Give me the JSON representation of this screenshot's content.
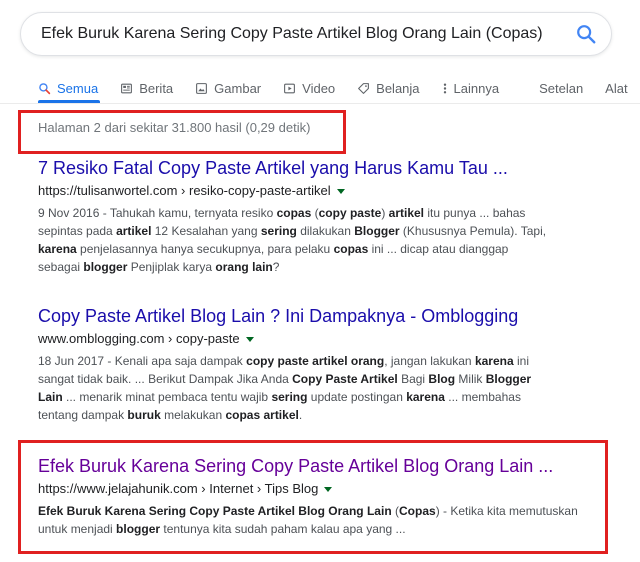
{
  "search": {
    "query": "Efek Buruk Karena Sering Copy Paste Artikel Blog Orang Lain (Copas)"
  },
  "tabs": [
    {
      "label": "Semua",
      "icon": "search-icon",
      "active": true
    },
    {
      "label": "Berita",
      "icon": "newspaper-icon"
    },
    {
      "label": "Gambar",
      "icon": "image-icon"
    },
    {
      "label": "Video",
      "icon": "video-icon"
    },
    {
      "label": "Belanja",
      "icon": "shopping-tag-icon"
    },
    {
      "label": "Lainnya",
      "icon": "more-vert-icon"
    },
    {
      "label": "Setelan"
    },
    {
      "label": "Alat"
    }
  ],
  "result_stats": "Halaman 2 dari sekitar 31.800 hasil (0,29 detik)",
  "results": [
    {
      "title": "7 Resiko Fatal Copy Paste Artikel yang Harus Kamu Tau ...",
      "url": "https://tulisanwortel.com › resiko-copy-paste-artikel",
      "snippet_lines": [
        [
          [
            "9 Nov 2016 - Tahukah kamu, ternyata resiko ",
            0
          ],
          [
            "copas",
            1
          ],
          [
            " (",
            0
          ],
          [
            "copy paste",
            1
          ],
          [
            ") ",
            0
          ],
          [
            "artikel",
            1
          ],
          [
            " itu punya ... bahas",
            0
          ]
        ],
        [
          [
            "sepintas pada ",
            0
          ],
          [
            "artikel",
            1
          ],
          [
            " 12 Kesalahan yang ",
            0
          ],
          [
            "sering",
            1
          ],
          [
            " dilakukan ",
            0
          ],
          [
            "Blogger",
            1
          ],
          [
            " (Khususnya Pemula). Tapi,",
            0
          ]
        ],
        [
          [
            "karena",
            1
          ],
          [
            " penjelasannya hanya secukupnya, para pelaku ",
            0
          ],
          [
            "copas",
            1
          ],
          [
            " ini ... dicap atau dianggap",
            0
          ]
        ],
        [
          [
            "sebagai ",
            0
          ],
          [
            "blogger",
            1
          ],
          [
            " Penjiplak karya ",
            0
          ],
          [
            "orang lain",
            1
          ],
          [
            "?",
            0
          ]
        ]
      ]
    },
    {
      "title": "Copy Paste Artikel Blog Lain ? Ini Dampaknya - Omblogging",
      "url": "www.omblogging.com › copy-paste",
      "snippet_lines": [
        [
          [
            "18 Jun 2017 - Kenali apa saja dampak ",
            0
          ],
          [
            "copy paste artikel orang",
            1
          ],
          [
            ", jangan lakukan ",
            0
          ],
          [
            "karena",
            1
          ],
          [
            " ini",
            0
          ]
        ],
        [
          [
            "sangat tidak baik. ... Berikut Dampak Jika Anda ",
            0
          ],
          [
            "Copy Paste Artikel",
            1
          ],
          [
            " Bagi ",
            0
          ],
          [
            "Blog",
            1
          ],
          [
            " Milik ",
            0
          ],
          [
            "Blogger",
            1
          ]
        ],
        [
          [
            "Lain",
            1
          ],
          [
            " ... menarik minat pembaca tentu wajib ",
            0
          ],
          [
            "sering",
            1
          ],
          [
            " update postingan ",
            0
          ],
          [
            "karena",
            1
          ],
          [
            " ... membahas",
            0
          ]
        ],
        [
          [
            "tentang dampak ",
            0
          ],
          [
            "buruk",
            1
          ],
          [
            " melakukan ",
            0
          ],
          [
            "copas artikel",
            1
          ],
          [
            ".",
            0
          ]
        ]
      ]
    },
    {
      "title": "Efek Buruk Karena Sering Copy Paste Artikel Blog Orang Lain ...",
      "url": "https://www.jelajahunik.com › Internet › Tips Blog",
      "snippet_lines": [
        [
          [
            "Efek Buruk Karena Sering Copy Paste Artikel Blog Orang Lain",
            1
          ],
          [
            " (",
            0
          ],
          [
            "Copas",
            1
          ],
          [
            ") - Ketika kita memutuskan",
            0
          ]
        ],
        [
          [
            "untuk menjadi ",
            0
          ],
          [
            "blogger",
            1
          ],
          [
            " tentunya kita sudah paham kalau apa yang ...",
            0
          ]
        ]
      ]
    }
  ],
  "colors": {
    "link": "#1a0dab",
    "visited": "#660099",
    "accent": "#1a73e8",
    "highlight": "#e02020",
    "url_arrow": "#006621"
  }
}
